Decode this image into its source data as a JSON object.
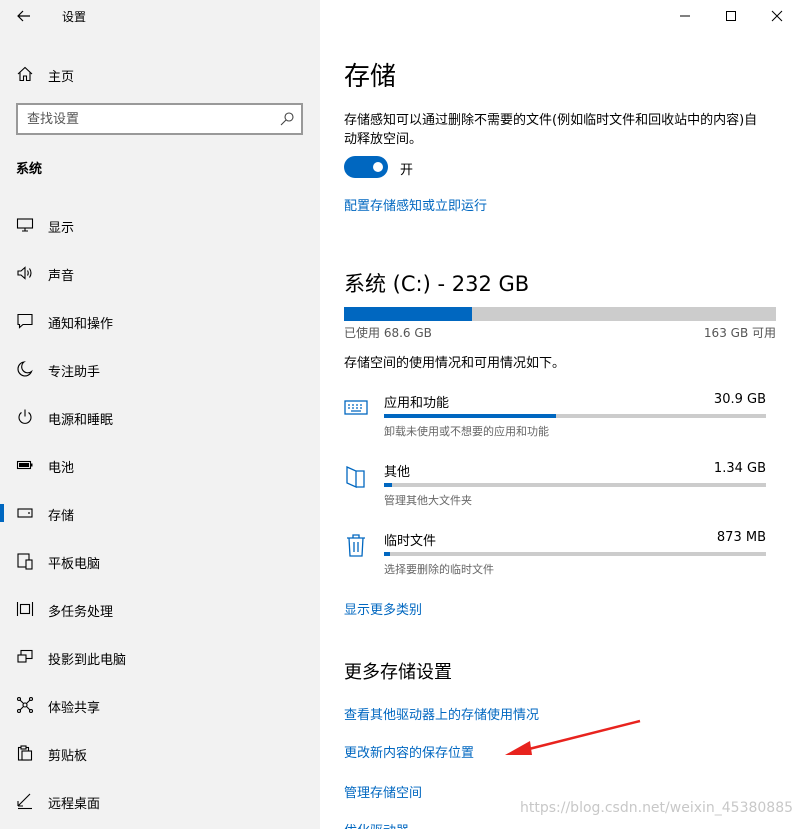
{
  "app": {
    "title": "设置"
  },
  "sidebar": {
    "home_label": "主页",
    "search_placeholder": "查找设置",
    "section_title": "系统",
    "items": [
      {
        "label": "显示",
        "icon": "display-icon"
      },
      {
        "label": "声音",
        "icon": "sound-icon"
      },
      {
        "label": "通知和操作",
        "icon": "notification-icon"
      },
      {
        "label": "专注助手",
        "icon": "moon-icon"
      },
      {
        "label": "电源和睡眠",
        "icon": "power-icon"
      },
      {
        "label": "电池",
        "icon": "battery-icon"
      },
      {
        "label": "存储",
        "icon": "storage-icon",
        "active": true
      },
      {
        "label": "平板电脑",
        "icon": "tablet-icon"
      },
      {
        "label": "多任务处理",
        "icon": "multitask-icon"
      },
      {
        "label": "投影到此电脑",
        "icon": "project-icon"
      },
      {
        "label": "体验共享",
        "icon": "share-icon"
      },
      {
        "label": "剪贴板",
        "icon": "clipboard-icon"
      },
      {
        "label": "远程桌面",
        "icon": "remote-desktop-icon"
      }
    ]
  },
  "main": {
    "title": "存储",
    "description": "存储感知可以通过删除不需要的文件(例如临时文件和回收站中的内容)自动释放空间。",
    "toggle": {
      "state": "on",
      "label": "开"
    },
    "configure_link": "配置存储感知或立即运行",
    "drive": {
      "title": "系统 (C:) - 232 GB",
      "used_label": "已使用 68.6 GB",
      "free_label": "163 GB 可用",
      "used_fraction": 0.296
    },
    "usage_desc": "存储空间的使用情况和可用情况如下。",
    "categories": [
      {
        "name": "应用和功能",
        "size": "30.9 GB",
        "sub": "卸载未使用或不想要的应用和功能",
        "fraction": 0.45,
        "icon": "keyboard-icon"
      },
      {
        "name": "其他",
        "size": "1.34 GB",
        "sub": "管理其他大文件夹",
        "fraction": 0.02,
        "icon": "folder-icon"
      },
      {
        "name": "临时文件",
        "size": "873 MB",
        "sub": "选择要删除的临时文件",
        "fraction": 0.015,
        "icon": "trash-icon"
      }
    ],
    "show_more_link": "显示更多类别",
    "more_title": "更多存储设置",
    "more_links": [
      "查看其他驱动器上的存储使用情况",
      "更改新内容的保存位置",
      "管理存储空间",
      "优化驱动器"
    ]
  },
  "watermark": "https://blog.csdn.net/weixin_45380885",
  "colors": {
    "accent": "#0067c0",
    "arrow": "#e8231e"
  }
}
